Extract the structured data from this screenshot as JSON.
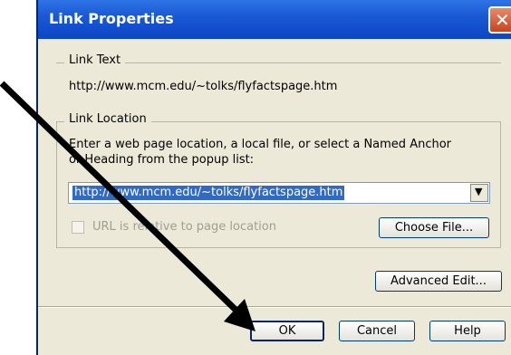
{
  "dialog": {
    "title": "Link Properties",
    "close_glyph": "✕",
    "link_text": {
      "legend": "Link Text",
      "value": "http://www.mcm.edu/~tolks/flyfactspage.htm"
    },
    "link_location": {
      "legend": "Link Location",
      "instructions_line1": "Enter a web page location, a local file, or select a Named Anchor",
      "instructions_line2": "or Heading from the popup list:",
      "url_value": "http://www.mcm.edu/~tolks/flyfactspage.htm",
      "dropdown_glyph": "▼",
      "relative_checkbox_label": "URL is relative to page location",
      "choose_file_label": "Choose File..."
    },
    "advanced_edit_label": "Advanced Edit...",
    "ok_label": "OK",
    "cancel_label": "Cancel",
    "help_label": "Help"
  },
  "colors": {
    "titlebar": "#0c46c6",
    "dialog_bg": "#ece9d8",
    "selection": "#316ac5",
    "close_button": "#c8441e",
    "arrow": "#000000"
  }
}
